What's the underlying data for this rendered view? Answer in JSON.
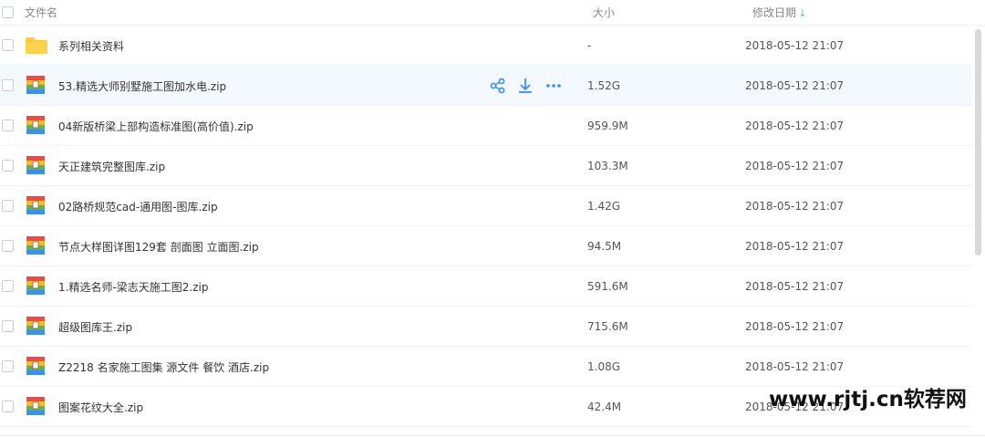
{
  "header": {
    "name_label": "文件名",
    "size_label": "大小",
    "date_label": "修改日期",
    "sort_icon": "arrow-down-icon"
  },
  "rows": [
    {
      "name": "系列相关资料",
      "size": "-",
      "date": "2018-05-12 21:07",
      "type": "folder"
    },
    {
      "name": "53.精选大师别墅施工图加水电.zip",
      "size": "1.52G",
      "date": "2018-05-12 21:07",
      "type": "zip"
    },
    {
      "name": "04新版桥梁上部构造标准图(高价值).zip",
      "size": "959.9M",
      "date": "2018-05-12 21:07",
      "type": "zip"
    },
    {
      "name": "天正建筑完整图库.zip",
      "size": "103.3M",
      "date": "2018-05-12 21:07",
      "type": "zip"
    },
    {
      "name": "02路桥规范cad-通用图-图库.zip",
      "size": "1.42G",
      "date": "2018-05-12 21:07",
      "type": "zip"
    },
    {
      "name": "节点大样图详图129套 剖面图 立面图.zip",
      "size": "94.5M",
      "date": "2018-05-12 21:07",
      "type": "zip"
    },
    {
      "name": "1.精选名师-梁志天施工图2.zip",
      "size": "591.6M",
      "date": "2018-05-12 21:07",
      "type": "zip"
    },
    {
      "name": "超级图库王.zip",
      "size": "715.6M",
      "date": "2018-05-12 21:07",
      "type": "zip"
    },
    {
      "name": "Z2218 名家施工图集 源文件 餐饮 酒店.zip",
      "size": "1.08G",
      "date": "2018-05-12 21:07",
      "type": "zip"
    },
    {
      "name": "图案花纹大全.zip",
      "size": "42.4M",
      "date": "2018-05-12 21:07",
      "type": "zip"
    }
  ],
  "row_actions": [
    "share-icon",
    "download-icon",
    "more-icon"
  ],
  "watermark": "www.rjtj.cn软荐网",
  "colors": {
    "accent": "#3b8cff",
    "folder": "#ffc93c",
    "hover_row": "#f4f8ff"
  }
}
